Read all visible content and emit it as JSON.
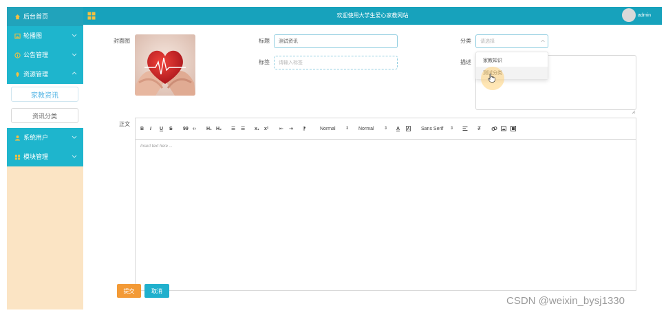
{
  "sidebar": {
    "items": [
      {
        "label": "后台首页",
        "icon": "home-icon"
      },
      {
        "label": "轮播图",
        "icon": "image-icon"
      },
      {
        "label": "公告管理",
        "icon": "info-icon"
      },
      {
        "label": "资源管理",
        "icon": "location-icon"
      },
      {
        "label": "系统用户",
        "icon": "user-icon"
      },
      {
        "label": "模块管理",
        "icon": "grid-icon"
      }
    ],
    "sub_items": [
      {
        "label": "家教资讯",
        "active": true
      },
      {
        "label": "资讯分类",
        "active": false
      }
    ]
  },
  "header": {
    "title": "欢迎使用大学生爱心家教网站",
    "user": "admin"
  },
  "form": {
    "cover_label": "封面图",
    "title_label": "标题",
    "title_value": "测试资讯",
    "tags_label": "标签",
    "tags_placeholder": "请输入标签",
    "category_label": "分类",
    "category_placeholder": "请选择",
    "description_label": "描述",
    "category_options": [
      "家教知识",
      "测试分类"
    ],
    "content_label": "正文"
  },
  "editor": {
    "toolbar": {
      "bold": "B",
      "italic": "I",
      "underline": "U",
      "strike": "S",
      "blockquote": "99",
      "code": "‹›",
      "h1": "H₁",
      "h2": "H₂",
      "ordered_list": "☰",
      "bullet_list": "☰",
      "subscript": "x₁",
      "superscript": "x²",
      "outdent": "⇤",
      "indent": "⇥",
      "direction": "⁋",
      "size": "Normal",
      "header": "Normal",
      "font": "Sans Serif"
    },
    "placeholder": "Insert text here ..."
  },
  "buttons": {
    "submit": "提交",
    "cancel": "取消"
  },
  "watermark": "CSDN @weixin_bysj1330",
  "colors": {
    "sidebar_bg": "#fbe4c4",
    "nav_item": "#1eb5cd",
    "header": "#17a2bc",
    "submit": "#f39a36",
    "cancel": "#20b0cd"
  }
}
